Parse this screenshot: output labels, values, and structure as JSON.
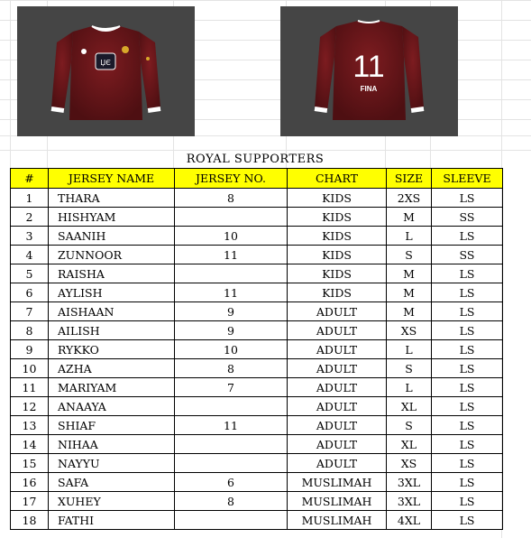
{
  "title": "ROYAL SUPPORTERS",
  "images": {
    "front_badge": "ЏЄ",
    "back_number": "11",
    "back_name": "FINA"
  },
  "headers": [
    "#",
    "JERSEY NAME",
    "JERSEY NO.",
    "CHART",
    "SIZE",
    "SLEEVE"
  ],
  "rows": [
    {
      "n": "1",
      "name": "THARA",
      "no": "8",
      "chart": "KIDS",
      "size": "2XS",
      "sleeve": "LS"
    },
    {
      "n": "2",
      "name": "HISHYAM",
      "no": "",
      "chart": "KIDS",
      "size": "M",
      "sleeve": "SS"
    },
    {
      "n": "3",
      "name": "SAANIH",
      "no": "10",
      "chart": "KIDS",
      "size": "L",
      "sleeve": "LS"
    },
    {
      "n": "4",
      "name": "ZUNNOOR",
      "no": "11",
      "chart": "KIDS",
      "size": "S",
      "sleeve": "SS"
    },
    {
      "n": "5",
      "name": "RAISHA",
      "no": "",
      "chart": "KIDS",
      "size": "M",
      "sleeve": "LS"
    },
    {
      "n": "6",
      "name": "AYLISH",
      "no": "11",
      "chart": "KIDS",
      "size": "M",
      "sleeve": "LS"
    },
    {
      "n": "7",
      "name": "AISHAAN",
      "no": "9",
      "chart": "ADULT",
      "size": "M",
      "sleeve": "LS"
    },
    {
      "n": "8",
      "name": "AILISH",
      "no": "9",
      "chart": "ADULT",
      "size": "XS",
      "sleeve": "LS"
    },
    {
      "n": "9",
      "name": "RYKKO",
      "no": "10",
      "chart": "ADULT",
      "size": "L",
      "sleeve": "LS"
    },
    {
      "n": "10",
      "name": "AZHA",
      "no": "8",
      "chart": "ADULT",
      "size": "S",
      "sleeve": "LS"
    },
    {
      "n": "11",
      "name": "MARIYAM",
      "no": "7",
      "chart": "ADULT",
      "size": "L",
      "sleeve": "LS"
    },
    {
      "n": "12",
      "name": "ANAAYA",
      "no": "",
      "chart": "ADULT",
      "size": "XL",
      "sleeve": "LS"
    },
    {
      "n": "13",
      "name": "SHIAF",
      "no": "11",
      "chart": "ADULT",
      "size": "S",
      "sleeve": "LS"
    },
    {
      "n": "14",
      "name": "NIHAA",
      "no": "",
      "chart": "ADULT",
      "size": "XL",
      "sleeve": "LS"
    },
    {
      "n": "15",
      "name": "NAYYU",
      "no": "",
      "chart": "ADULT",
      "size": "XS",
      "sleeve": "LS"
    },
    {
      "n": "16",
      "name": "SAFA",
      "no": "6",
      "chart": "MUSLIMAH",
      "size": "3XL",
      "sleeve": "LS"
    },
    {
      "n": "17",
      "name": "XUHEY",
      "no": "8",
      "chart": "MUSLIMAH",
      "size": "3XL",
      "sleeve": "LS"
    },
    {
      "n": "18",
      "name": "FATHI",
      "no": "",
      "chart": "MUSLIMAH",
      "size": "4XL",
      "sleeve": "LS"
    }
  ],
  "colors": {
    "header_bg": "#ffff00",
    "panel_bg": "#454545",
    "jersey": "#6b1518",
    "trim": "#ffffff"
  }
}
